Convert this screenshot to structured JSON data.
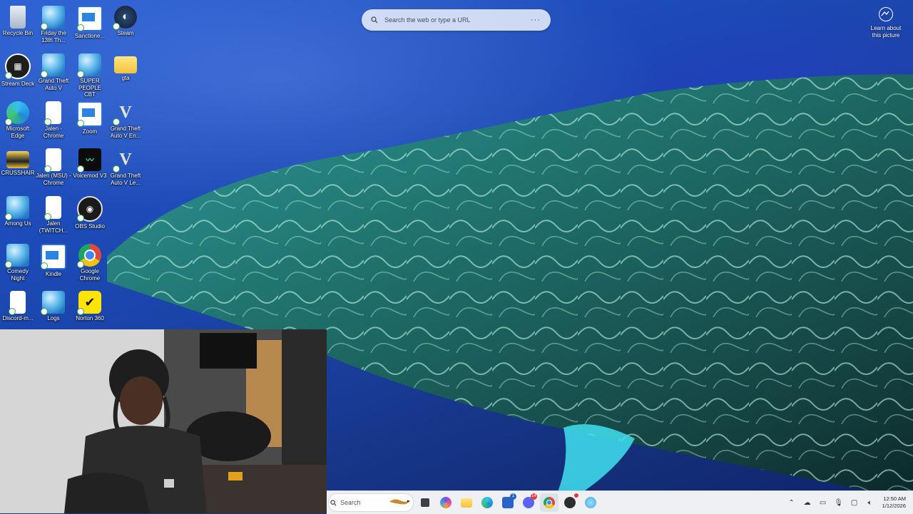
{
  "desktop_icons": [
    {
      "label": "Recycle Bin",
      "icon": "recycle-bin-icon"
    },
    {
      "label": "Friday the 13th Th...",
      "icon": "globe-icon"
    },
    {
      "label": "Sanctione...",
      "icon": "app-window-icon"
    },
    {
      "label": "Steam",
      "icon": "steam-icon"
    },
    {
      "label": "Stream Deck",
      "icon": "stream-deck-icon"
    },
    {
      "label": "Grand Theft Auto V",
      "icon": "globe-icon"
    },
    {
      "label": "SUPER PEOPLE CBT",
      "icon": "globe-icon"
    },
    {
      "label": "gta",
      "icon": "folder-icon"
    },
    {
      "label": "Microsoft Edge",
      "icon": "edge-icon"
    },
    {
      "label": "Jalen - Chrome",
      "icon": "document-icon"
    },
    {
      "label": "Zoom",
      "icon": "app-window-icon"
    },
    {
      "label": "Grand Theft Auto V En...",
      "icon": "gta-v-icon"
    },
    {
      "label": "CRUSSHAIR",
      "icon": "folder-icon"
    },
    {
      "label": "Jalen (MSU) - Chrome",
      "icon": "document-icon"
    },
    {
      "label": "Voicemod V3",
      "icon": "voicemod-icon"
    },
    {
      "label": "Grand Theft Auto V Le...",
      "icon": "gta-v-icon"
    },
    {
      "label": "Among Us",
      "icon": "globe-icon"
    },
    {
      "label": "Jalen (TWITCH...",
      "icon": "document-icon"
    },
    {
      "label": "OBS Studio",
      "icon": "obs-icon"
    },
    {
      "label": "Comedy Night",
      "icon": "globe-icon"
    },
    {
      "label": "Kindle",
      "icon": "app-window-icon"
    },
    {
      "label": "Google Chrome",
      "icon": "chrome-icon"
    },
    {
      "label": "Discord-m...",
      "icon": "document-icon"
    },
    {
      "label": "Logs",
      "icon": "globe-icon"
    },
    {
      "label": "Norton 360",
      "icon": "norton-icon"
    }
  ],
  "browser_search": {
    "placeholder": "Search the web or type a URL",
    "more": "···"
  },
  "spotlight": {
    "label_line1": "Learn about",
    "label_line2": "this picture"
  },
  "taskbar": {
    "search_placeholder": "Search",
    "apps": [
      {
        "name": "task-view",
        "color": "#3b3f47"
      },
      {
        "name": "copilot",
        "color": "#7b4fe0"
      },
      {
        "name": "file-explorer",
        "color": "#f2c23c"
      },
      {
        "name": "edge",
        "color": "#1f8ad6"
      },
      {
        "name": "store",
        "color": "#2a64c9",
        "badge": "1"
      },
      {
        "name": "discord",
        "color": "#5865f2",
        "badge": "14"
      },
      {
        "name": "chrome",
        "color": "#dd4b3e"
      },
      {
        "name": "obs",
        "color": "#2d2d2d"
      },
      {
        "name": "app-blue",
        "color": "#44a6e0"
      }
    ],
    "clock_time": "12:50 AM",
    "clock_date": "1/12/2026"
  }
}
